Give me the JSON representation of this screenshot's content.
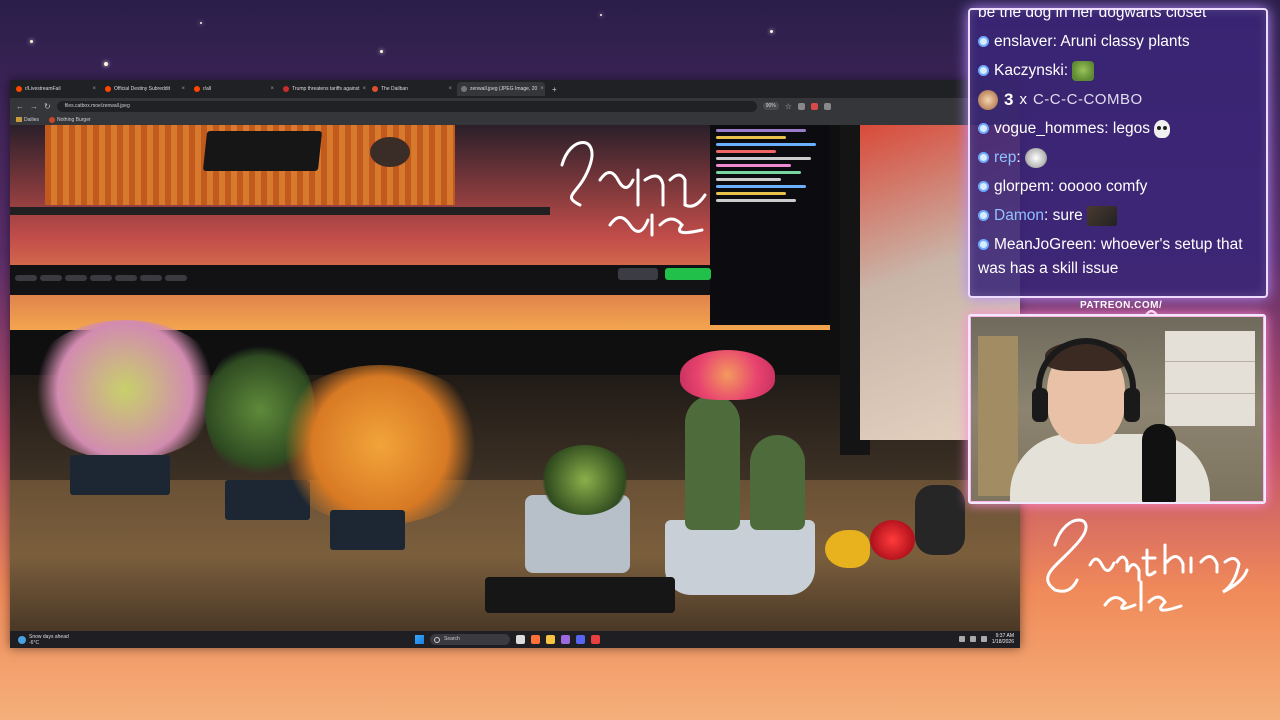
{
  "browser": {
    "tabs": [
      {
        "label": "r/LivestreamFail",
        "color": "#ff4500",
        "active": false
      },
      {
        "label": "Official Destiny Subreddit",
        "color": "#ff4500",
        "active": false
      },
      {
        "label": "r/all",
        "color": "#ff4500",
        "active": false
      },
      {
        "label": "Trump threatens tariffs against",
        "color": "#cc2b2b",
        "active": false
      },
      {
        "label": "The Dailban",
        "color": "#e0502c",
        "active": false
      },
      {
        "label": "zenwall.jpeg (JPEG Image, 20",
        "color": "#777777",
        "active": true
      }
    ],
    "url": "files.catbox.moe/zenwall.jpeg",
    "zoom": "90%",
    "bookmarks": [
      "Dailies",
      "Nothing Burger"
    ]
  },
  "taskbar": {
    "weather_title": "Snow days ahead",
    "weather_temp": "-6°C",
    "search_placeholder": "Search",
    "time": "9:37 AM",
    "date": "1/18/2026"
  },
  "chat": {
    "cut_line": "be the dog in her dogwarts closet",
    "messages": [
      {
        "user": "enslaver",
        "text": "Aruni classy plants",
        "name_style": "white"
      },
      {
        "user": "Kaczynski",
        "text": "",
        "emote": "pepe",
        "name_style": "white"
      },
      {
        "user": "vogue_hommes",
        "text": "legos",
        "emote": "skull",
        "name_style": "white"
      },
      {
        "user": "rep",
        "text": "",
        "emote": "dog",
        "name_style": "blue"
      },
      {
        "user": "glorpem",
        "text": "ooooo comfy",
        "name_style": "white"
      },
      {
        "user": "Damon",
        "text": "sure",
        "emote": "photo",
        "name_style": "blue"
      },
      {
        "user": "MeanJoGreen",
        "text": "whoever's setup that was has a skill issue",
        "name_style": "white"
      }
    ],
    "combo": {
      "count": "3",
      "multiplier": "x",
      "text": "C-C-C-COMBO"
    }
  },
  "overlay": {
    "patreon": "PATREON.COM/"
  },
  "colors": {
    "chat_bg": "#3a2678",
    "chat_border": "#eddcff",
    "cam_glow": "#ff8ad8",
    "accent_green": "#21c04a"
  },
  "icons": [
    "back-arrow-icon",
    "forward-arrow-icon",
    "reload-icon",
    "lock-icon",
    "star-icon",
    "windows-logo-icon",
    "search-icon",
    "chat-bullet-icon"
  ]
}
